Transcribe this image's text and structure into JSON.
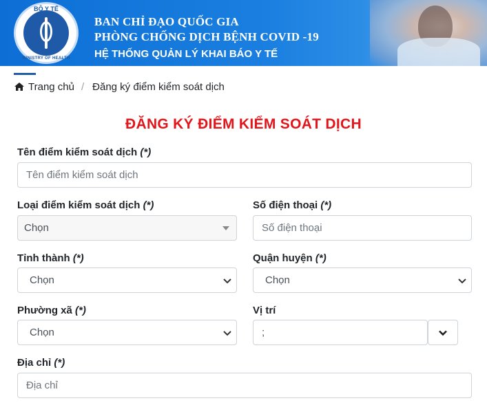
{
  "header": {
    "logo_top_text": "BỘ Y TẾ",
    "logo_bottom_text": "MINISTRY OF HEALTH",
    "line1": "BAN CHỈ ĐẠO QUỐC GIA",
    "line2": "PHÒNG CHỐNG DỊCH BỆNH COVID -19",
    "line3": "HỆ THỐNG QUẢN LÝ KHAI BÁO Y TẾ"
  },
  "breadcrumb": {
    "home_label": "Trang chủ",
    "separator": "/",
    "current": "Đăng ký điểm kiểm soát dịch"
  },
  "title": "ĐĂNG KÝ ĐIỂM KIỂM SOÁT DỊCH",
  "form": {
    "required_mark": "(*)",
    "name": {
      "label": "Tên điểm kiểm soát dịch",
      "placeholder": "Tên điểm kiểm soát dịch"
    },
    "type": {
      "label": "Loại điểm kiểm soát dịch",
      "value": "Chọn"
    },
    "phone": {
      "label": "Số điện thoại",
      "placeholder": "Số điện thoại"
    },
    "province": {
      "label": "Tỉnh thành",
      "value": "Chọn"
    },
    "district": {
      "label": "Quận huyện",
      "value": "Chọn"
    },
    "ward": {
      "label": "Phường xã",
      "value": "Chọn"
    },
    "location": {
      "label": "Vị trí",
      "value": ";"
    },
    "address": {
      "label": "Địa chỉ",
      "placeholder": "Địa chỉ"
    }
  },
  "colors": {
    "banner": "#1a7fe0",
    "title": "#e3151a",
    "accent": "#1f5aa8"
  }
}
